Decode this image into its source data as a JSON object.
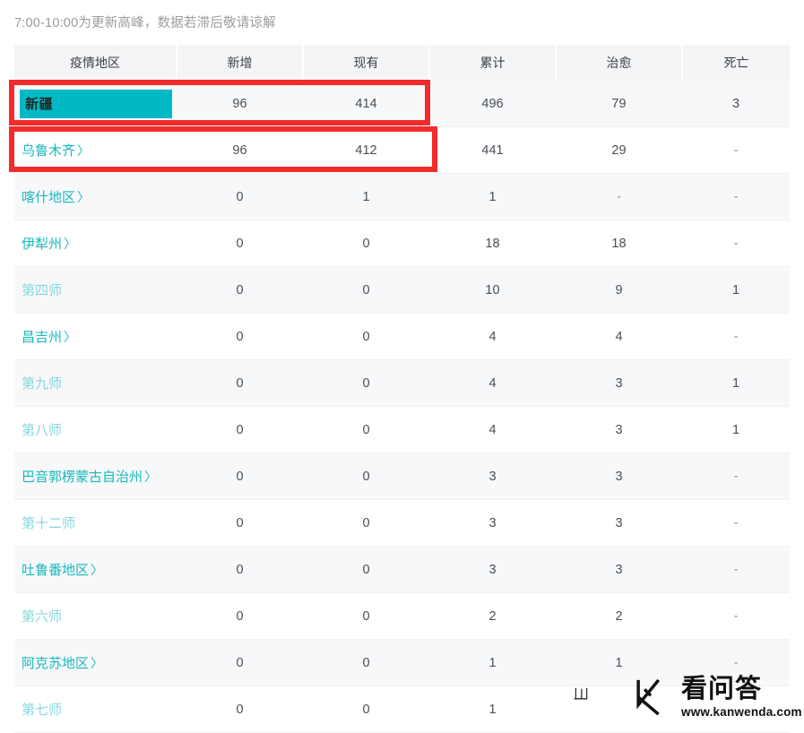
{
  "notice": "7:00-10:00为更新高峰，数据若滞后敬请谅解",
  "table": {
    "headers": [
      "疫情地区",
      "新增",
      "现有",
      "累计",
      "治愈",
      "死亡"
    ],
    "rows": [
      {
        "region": "新疆",
        "link": false,
        "selected": true,
        "new": "96",
        "current": "414",
        "total": "496",
        "cured": "79",
        "deaths": "3"
      },
      {
        "region": "乌鲁木齐",
        "link": true,
        "selected": false,
        "new": "96",
        "current": "412",
        "total": "441",
        "cured": "29",
        "deaths": "-"
      },
      {
        "region": "喀什地区",
        "link": true,
        "selected": false,
        "new": "0",
        "current": "1",
        "total": "1",
        "cured": "-",
        "deaths": "-"
      },
      {
        "region": "伊犁州",
        "link": true,
        "selected": false,
        "new": "0",
        "current": "0",
        "total": "18",
        "cured": "18",
        "deaths": "-"
      },
      {
        "region": "第四师",
        "link": false,
        "selected": false,
        "new": "0",
        "current": "0",
        "total": "10",
        "cured": "9",
        "deaths": "1"
      },
      {
        "region": "昌吉州",
        "link": true,
        "selected": false,
        "new": "0",
        "current": "0",
        "total": "4",
        "cured": "4",
        "deaths": "-"
      },
      {
        "region": "第九师",
        "link": false,
        "selected": false,
        "new": "0",
        "current": "0",
        "total": "4",
        "cured": "3",
        "deaths": "1"
      },
      {
        "region": "第八师",
        "link": false,
        "selected": false,
        "new": "0",
        "current": "0",
        "total": "4",
        "cured": "3",
        "deaths": "1"
      },
      {
        "region": "巴音郭楞蒙古自治州",
        "link": true,
        "selected": false,
        "new": "0",
        "current": "0",
        "total": "3",
        "cured": "3",
        "deaths": "-"
      },
      {
        "region": "第十二师",
        "link": false,
        "selected": false,
        "new": "0",
        "current": "0",
        "total": "3",
        "cured": "3",
        "deaths": "-"
      },
      {
        "region": "吐鲁番地区",
        "link": true,
        "selected": false,
        "new": "0",
        "current": "0",
        "total": "3",
        "cured": "3",
        "deaths": "-"
      },
      {
        "region": "第六师",
        "link": false,
        "selected": false,
        "new": "0",
        "current": "0",
        "total": "2",
        "cured": "2",
        "deaths": "-"
      },
      {
        "region": "阿克苏地区",
        "link": true,
        "selected": false,
        "new": "0",
        "current": "0",
        "total": "1",
        "cured": "1",
        "deaths": "-"
      },
      {
        "region": "第七师",
        "link": false,
        "selected": false,
        "new": "0",
        "current": "0",
        "total": "1",
        "cured": "",
        "deaths": ""
      }
    ]
  },
  "annotations": {
    "highlight_color": "#f32b2b",
    "selection_color": "#00b9c4",
    "boxes": [
      {
        "id": "redbox-1",
        "target": "新疆"
      },
      {
        "id": "redbox-2",
        "target": "乌鲁木齐"
      }
    ]
  },
  "watermark": {
    "name": "看问答",
    "url": "www.kanwenda.com",
    "logo": "k-logo-icon",
    "stray_glyph": "彐"
  },
  "chevron": "〉"
}
